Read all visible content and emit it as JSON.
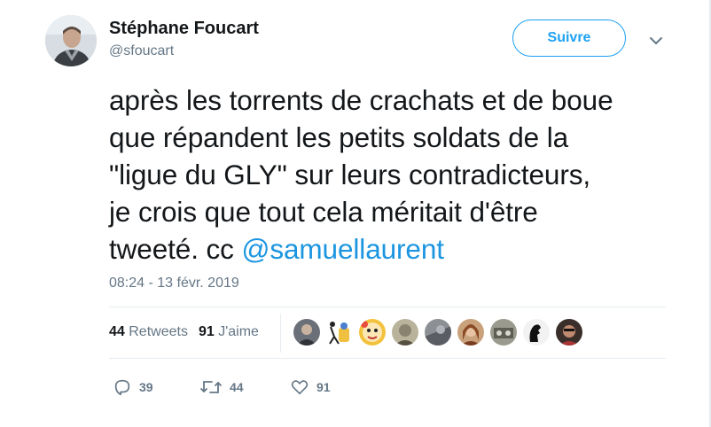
{
  "author": {
    "display_name": "Stéphane Foucart",
    "handle": "@sfoucart"
  },
  "follow_button": {
    "label": "Suivre"
  },
  "tweet": {
    "lines": [
      "après les torrents de crachats et de boue",
      "que répandent les petits soldats de la",
      "\"ligue du GLY\" sur leurs contradicteurs,",
      "je crois que tout cela méritait d'être",
      "tweeté. cc "
    ],
    "mention": "@samuellaurent",
    "timestamp": "08:24 - 13 févr. 2019"
  },
  "stats": {
    "retweets_count": "44",
    "retweets_label": "Retweets",
    "likes_count": "91",
    "likes_label": "J'aime"
  },
  "likers": [
    {
      "icon": "avatar-liker-1"
    },
    {
      "icon": "avatar-liker-2"
    },
    {
      "icon": "avatar-liker-3"
    },
    {
      "icon": "avatar-liker-4"
    },
    {
      "icon": "avatar-liker-5"
    },
    {
      "icon": "avatar-liker-6"
    },
    {
      "icon": "avatar-liker-7"
    },
    {
      "icon": "avatar-liker-8"
    },
    {
      "icon": "avatar-liker-9"
    }
  ],
  "actions": {
    "reply_count": "39",
    "retweet_count": "44",
    "like_count": "91"
  },
  "colors": {
    "accent": "#1da1f2",
    "mention": "#1b95e0",
    "secondary_text": "#657786",
    "divider": "#e6ecf0"
  }
}
